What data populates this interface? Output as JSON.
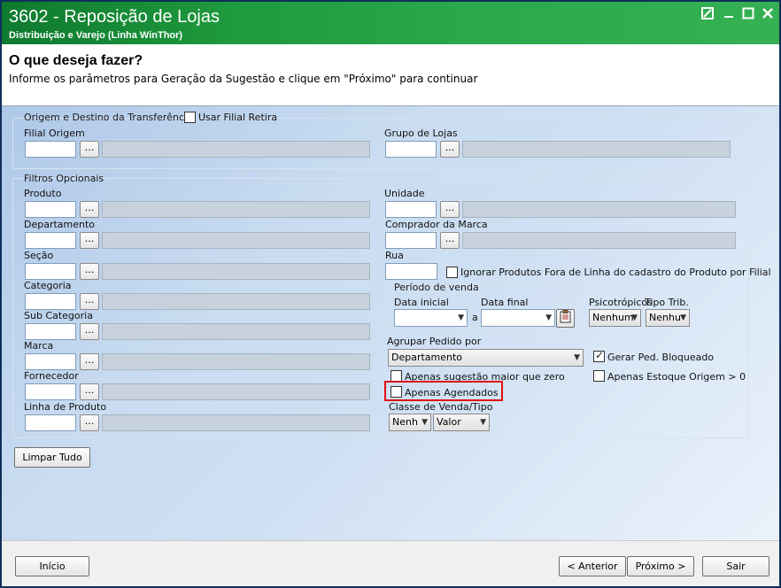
{
  "window": {
    "title": "3602 - Reposição de Lojas",
    "subtitle": "Distribuição e Varejo (Linha WinThor)",
    "controls": [
      "restore-icon",
      "minimize-icon",
      "maximize-icon",
      "close-icon"
    ]
  },
  "header": {
    "title": "O que deseja fazer?",
    "description": "Informe os parâmetros para Geração da Sugestão e clique em \"Próximo\" para continuar"
  },
  "origem": {
    "legend": "Origem e Destino da Transferência",
    "usar_filial_retira": "Usar Filial Retira",
    "filial_origem": "Filial Origem",
    "grupo_lojas": "Grupo de Lojas",
    "dots": "..."
  },
  "filtros": {
    "legend": "Filtros Opcionais",
    "left_fields": [
      "Produto",
      "Departamento",
      "Seção",
      "Categoria",
      "Sub Categoria",
      "Marca",
      "Fornecedor",
      "Linha de Produto"
    ],
    "unidade": "Unidade",
    "comprador_marca": "Comprador da Marca",
    "rua": "Rua",
    "ignorar_fora_linha": "Ignorar Produtos Fora de Linha do cadastro do Produto por Filial",
    "periodo_venda": "Período de venda",
    "data_inicial": "Data inicial",
    "a": "a",
    "data_final": "Data final",
    "psicotropicos": "Psicotrópicos",
    "psicotropicos_value": "Nenhum",
    "tipo_trib": "Tipo Trib.",
    "tipo_trib_value": "Nenhu",
    "agrupar_pedido_por": "Agrupar Pedido por",
    "agrupar_value": "Departamento",
    "gerar_ped_bloqueado": "Gerar Ped. Bloqueado",
    "apenas_sugestao_maior_zero": "Apenas sugestão maior que zero",
    "apenas_estoque_origem": "Apenas Estoque Origem > 0",
    "apenas_agendados": "Apenas Agendados",
    "classe_venda_tipo": "Classe de Venda/Tipo",
    "classe_value": "Nenh",
    "tipo_value": "Valor"
  },
  "buttons": {
    "limpar_tudo": "Limpar Tudo",
    "inicio": "Início",
    "anterior": "< Anterior",
    "proximo": "Próximo >",
    "sair": "Sair"
  },
  "colors": {
    "titlebar": "#1f9a3d",
    "highlight": "#e01010",
    "content_bg": "#c9dcf1"
  }
}
